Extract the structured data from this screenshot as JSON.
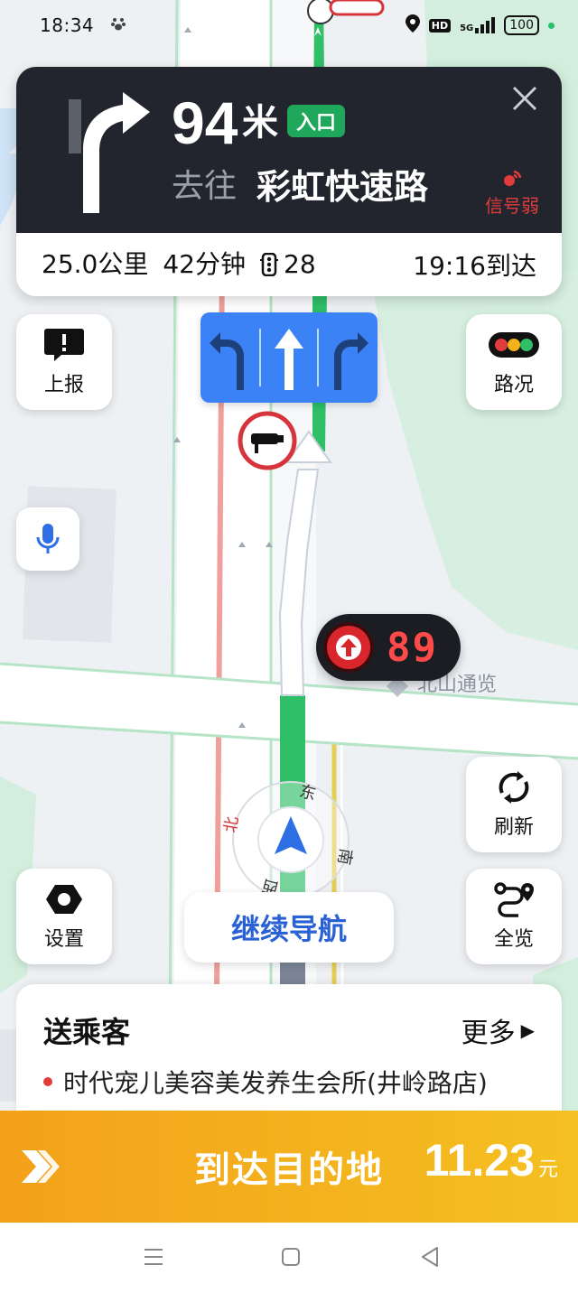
{
  "status_bar": {
    "time": "18:34",
    "hd": "HD",
    "network": "5G",
    "battery": "100",
    "app_icon": "baidu-paw-icon"
  },
  "maneuver": {
    "distance_value": "94",
    "distance_unit": "米",
    "badge": "入口",
    "goto_label": "去往",
    "road_name": "彩虹快速路",
    "signal_text": "信号弱",
    "turn_icon": "turn-right-arrow-icon"
  },
  "trip": {
    "distance": "25.0公里",
    "duration": "42分钟",
    "traffic_lights": "28",
    "arrival": "19:16到达"
  },
  "buttons": {
    "report": "上报",
    "traffic": "路况",
    "refresh": "刷新",
    "settings": "设置",
    "overview": "全览",
    "continue_nav": "继续导航"
  },
  "map": {
    "poi_label": "北山通览",
    "countdown": "89",
    "compass_labels": {
      "north": "北",
      "east": "东",
      "south": "南",
      "west": "西"
    }
  },
  "passenger": {
    "title": "送乘客",
    "more": "更多",
    "destination": "时代宠儿美容美发养生会所(井岭路店)"
  },
  "arrival_bar": {
    "label": "到达目的地",
    "fare_value": "11.23",
    "fare_unit": "元"
  },
  "colors": {
    "header_dark": "#22252d",
    "entry_green": "#1fa85b",
    "lane_blue": "#3b82f6",
    "arrive_orange": "#f3a11a",
    "continue_blue": "#2a62d6",
    "warning_red": "#e23b3b"
  }
}
